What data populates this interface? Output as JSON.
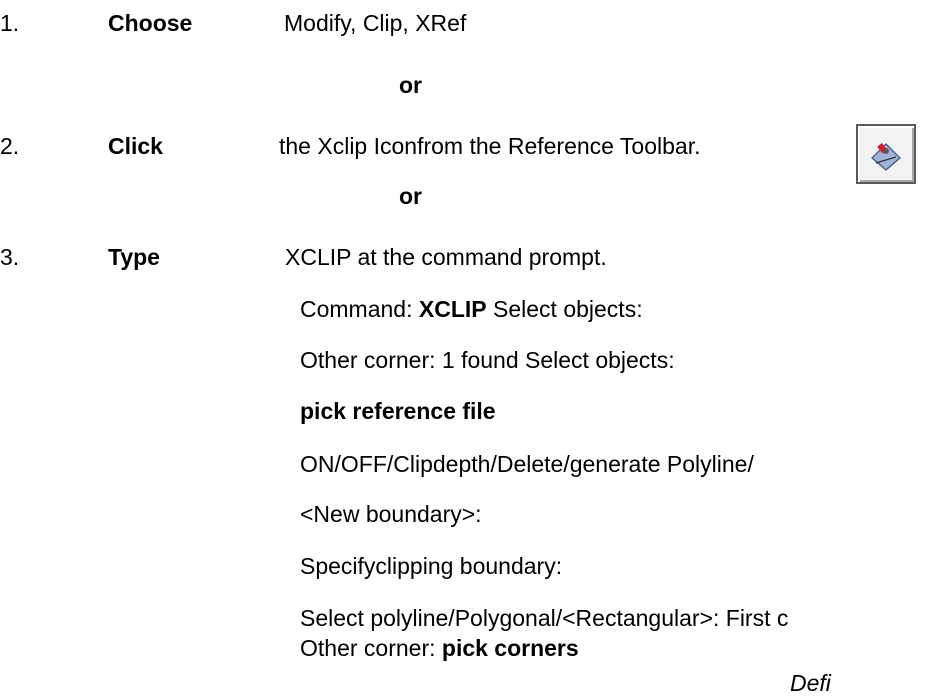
{
  "steps": [
    {
      "num": "1.",
      "verb": "Choose",
      "text": "Modify, Clip, XRef"
    },
    {
      "num": "2.",
      "verb": "Click",
      "text": "the Xclip Iconfrom the Reference Toolbar."
    },
    {
      "num": "3.",
      "verb": "Type",
      "text": "XCLIP  at the command prompt."
    }
  ],
  "or_label": "or",
  "commands": {
    "line1_prefix": "Command: ",
    "line1_bold": "XCLIP",
    "line1_suffix": " Select objects:",
    "line2": "Other corner: 1 found Select objects:",
    "line3": "pick reference file",
    "line4": "ON/OFF/Clipdepth/Delete/generate Polyline/",
    "line5": "<New  boundary>:",
    "line6": "Specifyclipping boundary:",
    "line7": "Select polyline/Polygonal/<Rectangular>: First c",
    "line8_prefix": "Other corner: ",
    "line8_bold": "pick corners",
    "line9_partial": "Defi"
  },
  "icons": {
    "xclip": "xclip-toolbar-icon"
  }
}
